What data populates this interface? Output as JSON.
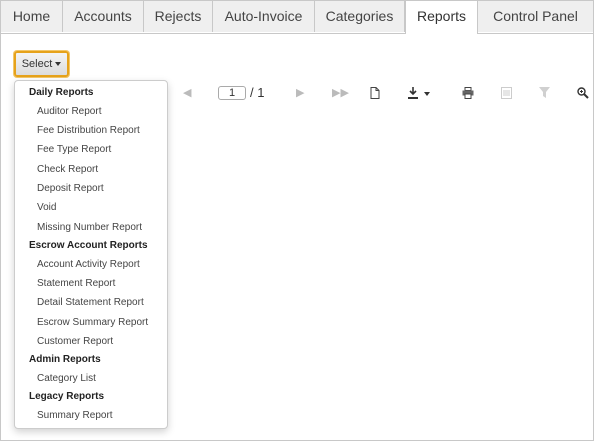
{
  "tabs": [
    {
      "label": "Home",
      "active": false
    },
    {
      "label": "Accounts",
      "active": false
    },
    {
      "label": "Rejects",
      "active": false
    },
    {
      "label": "Auto-Invoice",
      "active": false
    },
    {
      "label": "Categories",
      "active": false
    },
    {
      "label": "Reports",
      "active": true
    },
    {
      "label": "Control Panel",
      "active": false
    }
  ],
  "select_button": {
    "label": "Select"
  },
  "toolbar": {
    "page_value": "1",
    "page_total": "/ 1",
    "icons": [
      "first-page-icon",
      "prev-page-icon",
      "next-page-icon",
      "last-page-icon",
      "document-icon",
      "download-icon",
      "print-icon",
      "layout-icon",
      "filter-icon",
      "zoom-icon"
    ]
  },
  "menu": {
    "groups": [
      {
        "header": "Daily Reports",
        "items": [
          "Auditor Report",
          "Fee Distribution Report",
          "Fee Type Report",
          "Check Report",
          "Deposit Report",
          "Void",
          "Missing Number Report"
        ]
      },
      {
        "header": "Escrow Account Reports",
        "items": [
          "Account Activity Report",
          "Statement Report",
          "Detail Statement Report",
          "Escrow Summary Report",
          "Customer Report"
        ]
      },
      {
        "header": "Admin Reports",
        "items": [
          "Category List"
        ]
      },
      {
        "header": "Legacy Reports",
        "items": [
          "Summary Report"
        ]
      }
    ]
  },
  "colors": {
    "accent_border": "#e6a21a",
    "tab_bg": "#efefef",
    "active_tab_bg": "#ffffff"
  }
}
